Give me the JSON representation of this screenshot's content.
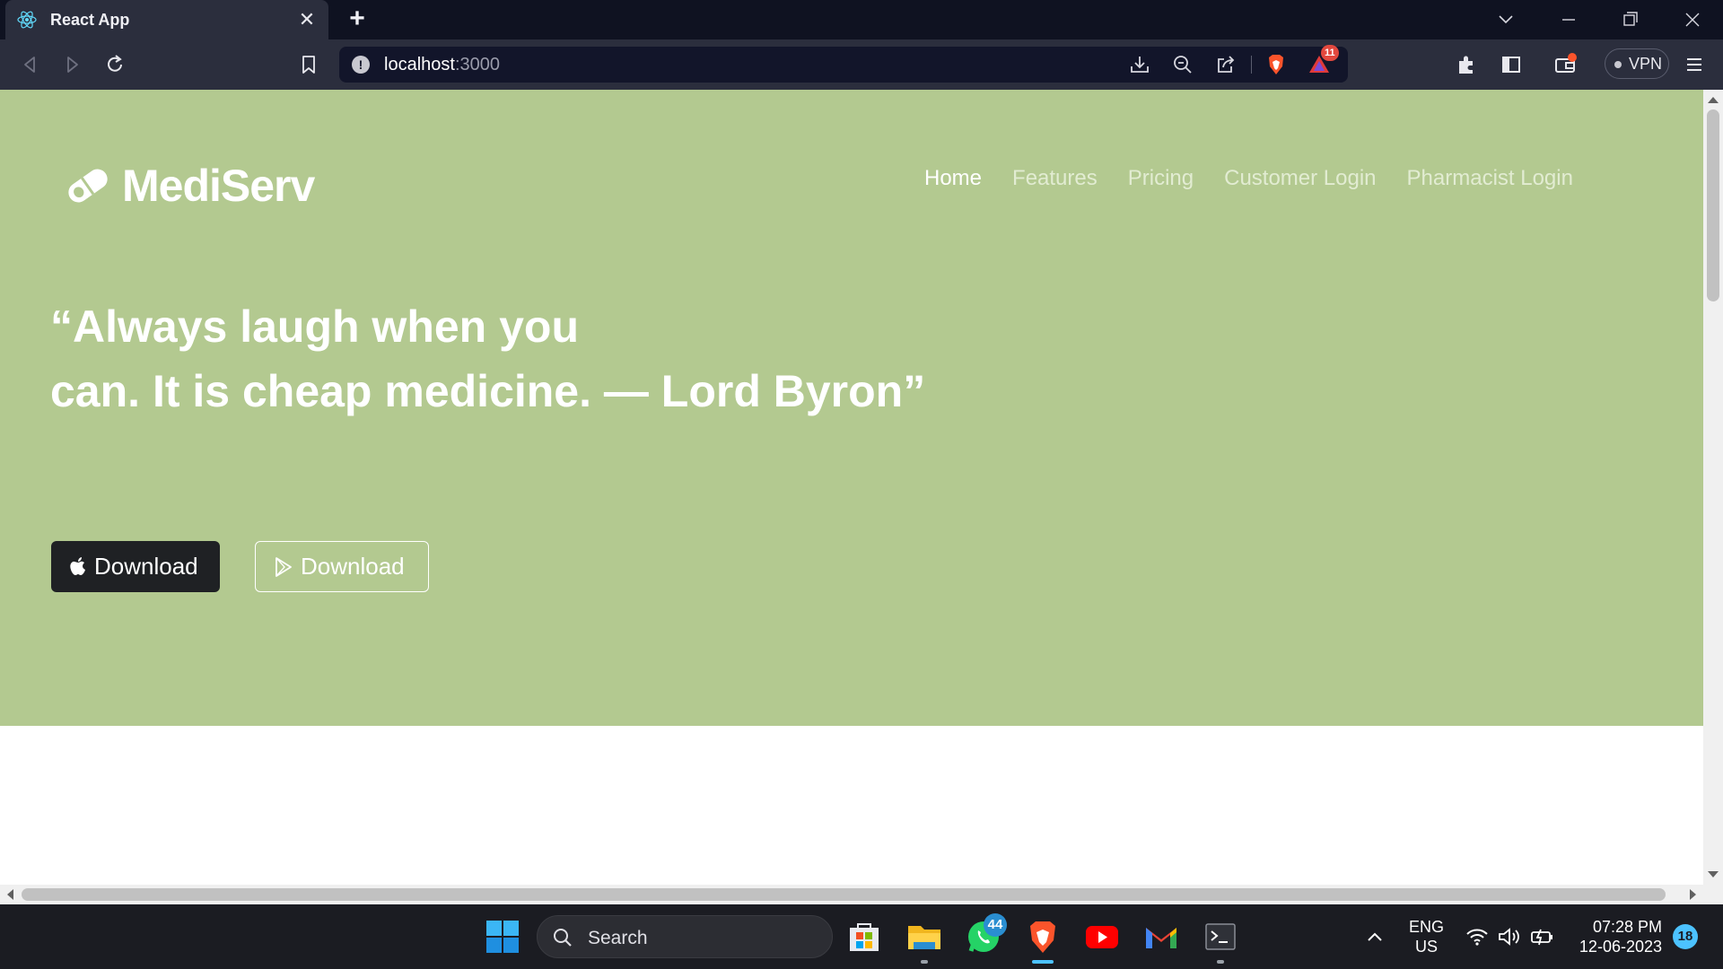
{
  "browser": {
    "tab_title": "React App",
    "url_host": "localhost",
    "url_port": ":3000",
    "vpn_label": "VPN",
    "rewards_badge": "11",
    "icons": [
      "back-icon",
      "forward-icon",
      "reload-icon",
      "bookmark-icon",
      "site-info-icon",
      "download-icon",
      "zoom-out-icon",
      "share-icon",
      "brave-shields-icon",
      "brave-rewards-icon",
      "extensions-icon",
      "sidebar-icon",
      "wallet-icon",
      "menu-icon"
    ]
  },
  "page": {
    "brand": "MediServ",
    "nav": [
      {
        "label": "Home",
        "active": true
      },
      {
        "label": "Features",
        "active": false
      },
      {
        "label": "Pricing",
        "active": false
      },
      {
        "label": "Customer Login",
        "active": false
      },
      {
        "label": "Pharmacist Login",
        "active": false
      }
    ],
    "quote_line1": "“Always laugh when you",
    "quote_line2": "can. It is cheap medicine. — Lord Byron”",
    "download_apple_label": "Download",
    "download_play_label": "Download",
    "colors": {
      "hero_bg": "#b3c990",
      "dark_button": "#1f2124"
    }
  },
  "taskbar": {
    "search_label": "Search",
    "whatsapp_badge": "44",
    "lang_line1": "ENG",
    "lang_line2": "US",
    "time": "07:28 PM",
    "date": "12-06-2023",
    "notification_count": "18"
  }
}
